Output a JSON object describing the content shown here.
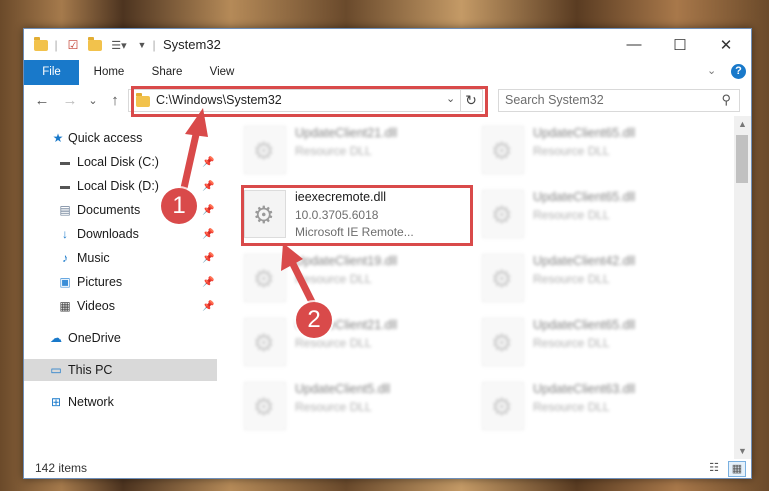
{
  "window": {
    "title": "System32",
    "controls": {
      "minimize": "—",
      "maximize": "☐",
      "close": "✕"
    }
  },
  "ribbon": {
    "tabs": [
      "File",
      "Home",
      "Share",
      "View"
    ],
    "help": "?"
  },
  "navigation": {
    "back": "←",
    "forward": "→",
    "recent": "⌄",
    "up": "↑",
    "address": "C:\\Windows\\System32",
    "search_placeholder": "Search System32"
  },
  "sidebar": {
    "items": [
      {
        "label": "Quick access",
        "icon": "star-icon"
      },
      {
        "label": "Local Disk (C:)",
        "icon": "drive-icon"
      },
      {
        "label": "Local Disk (D:)",
        "icon": "drive-icon"
      },
      {
        "label": "Documents",
        "icon": "documents-icon"
      },
      {
        "label": "Downloads",
        "icon": "downloads-icon"
      },
      {
        "label": "Music",
        "icon": "music-icon"
      },
      {
        "label": "Pictures",
        "icon": "pictures-icon"
      },
      {
        "label": "Videos",
        "icon": "videos-icon"
      },
      {
        "label": "OneDrive",
        "icon": "cloud-icon"
      },
      {
        "label": "This PC",
        "icon": "computer-icon"
      },
      {
        "label": "Network",
        "icon": "network-icon"
      }
    ]
  },
  "files": [
    {
      "name": "UpdateClient21.dll",
      "type": "Resource DLL"
    },
    {
      "name": "UpdateClient65.dll",
      "type": "Resource DLL"
    },
    {
      "name": "ieexecremote.dll",
      "version": "10.0.3705.6018",
      "description": "Microsoft IE Remote..."
    },
    {
      "name": "UpdateClient65.dll",
      "type": "Resource DLL"
    },
    {
      "name": "UpdateClient19.dll",
      "type": "Resource DLL"
    },
    {
      "name": "UpdateClient42.dll",
      "type": "Resource DLL"
    },
    {
      "name": "UpdateClient21.dll",
      "type": "Resource DLL"
    },
    {
      "name": "UpdateClient65.dll",
      "type": "Resource DLL"
    },
    {
      "name": "UpdateClient5.dll",
      "type": "Resource DLL"
    },
    {
      "name": "UpdateClient63.dll",
      "type": "Resource DLL"
    }
  ],
  "status": {
    "item_count": "142 items"
  },
  "callouts": [
    "1",
    "2"
  ],
  "colors": {
    "accent": "#1979ca",
    "highlight": "#d94a4a"
  }
}
